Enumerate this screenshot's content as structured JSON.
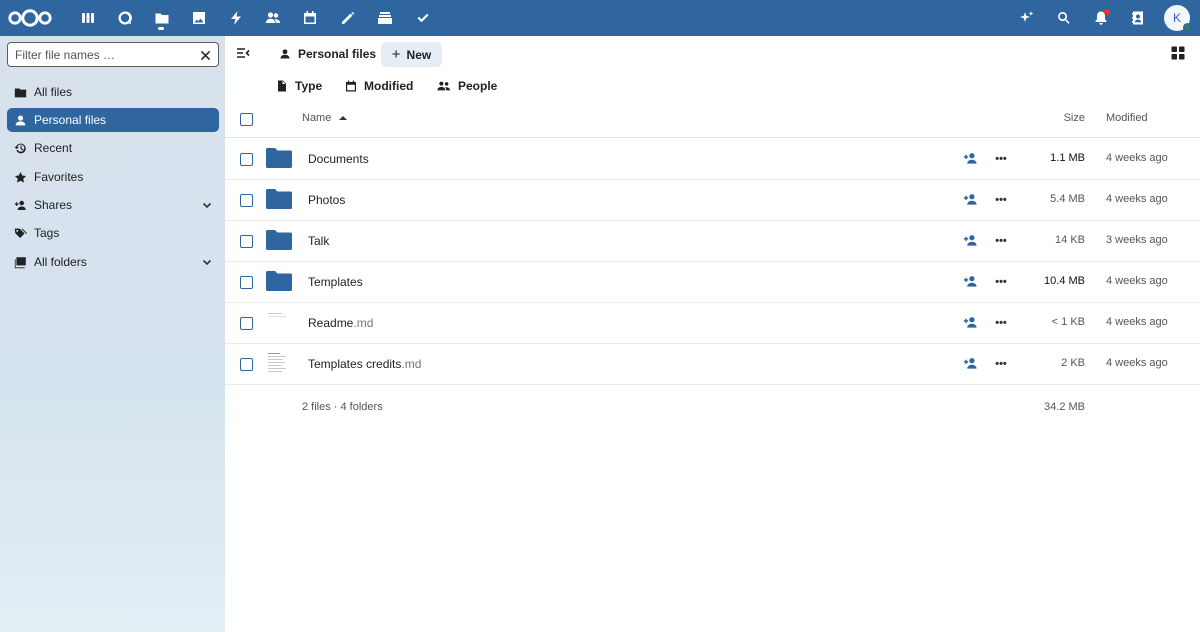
{
  "header": {
    "apps": [
      "dashboard-icon",
      "talk-icon",
      "files-icon",
      "photos-icon",
      "activity-icon",
      "contacts-icon",
      "calendar-icon",
      "notes-icon",
      "deck-icon",
      "tasks-icon"
    ],
    "avatar_letter": "K",
    "right_icons": [
      "assistant-icon",
      "search-icon",
      "notifications-icon",
      "contacts-menu-icon"
    ]
  },
  "sidebar": {
    "filter_placeholder": "Filter file names …",
    "items": [
      {
        "label": "All files",
        "icon": "folder-icon"
      },
      {
        "label": "Personal files",
        "icon": "user-icon",
        "active": true
      },
      {
        "label": "Recent",
        "icon": "history-icon"
      },
      {
        "label": "Favorites",
        "icon": "star-icon"
      },
      {
        "label": "Shares",
        "icon": "share-icon",
        "expandable": true
      },
      {
        "label": "Tags",
        "icon": "tag-icon"
      },
      {
        "label": "All folders",
        "icon": "folders-icon",
        "expandable": true
      }
    ]
  },
  "toolbar": {
    "breadcrumb": "Personal files",
    "new_label": "New",
    "filters": [
      "Type",
      "Modified",
      "People"
    ]
  },
  "table": {
    "headers": {
      "name": "Name",
      "size": "Size",
      "modified": "Modified"
    },
    "rows": [
      {
        "name": "Documents",
        "ext": "",
        "kind": "folder",
        "size": "1.1 MB",
        "modified": "4 weeks ago"
      },
      {
        "name": "Photos",
        "ext": "",
        "kind": "folder",
        "size": "5.4 MB",
        "modified": "4 weeks ago"
      },
      {
        "name": "Talk",
        "ext": "",
        "kind": "folder",
        "size": "14 KB",
        "modified": "3 weeks ago"
      },
      {
        "name": "Templates",
        "ext": "",
        "kind": "folder",
        "size": "10.4 MB",
        "modified": "4 weeks ago"
      },
      {
        "name": "Readme",
        "ext": ".md",
        "kind": "file",
        "size": "< 1 KB",
        "modified": "4 weeks ago"
      },
      {
        "name": "Templates credits",
        "ext": ".md",
        "kind": "file",
        "size": "2 KB",
        "modified": "4 weeks ago"
      }
    ],
    "summary": "2 files · 4 folders",
    "summary_size": "34.2 MB"
  },
  "colors": {
    "accent": "#2f66a0",
    "header_bg": "#2f66a0"
  }
}
